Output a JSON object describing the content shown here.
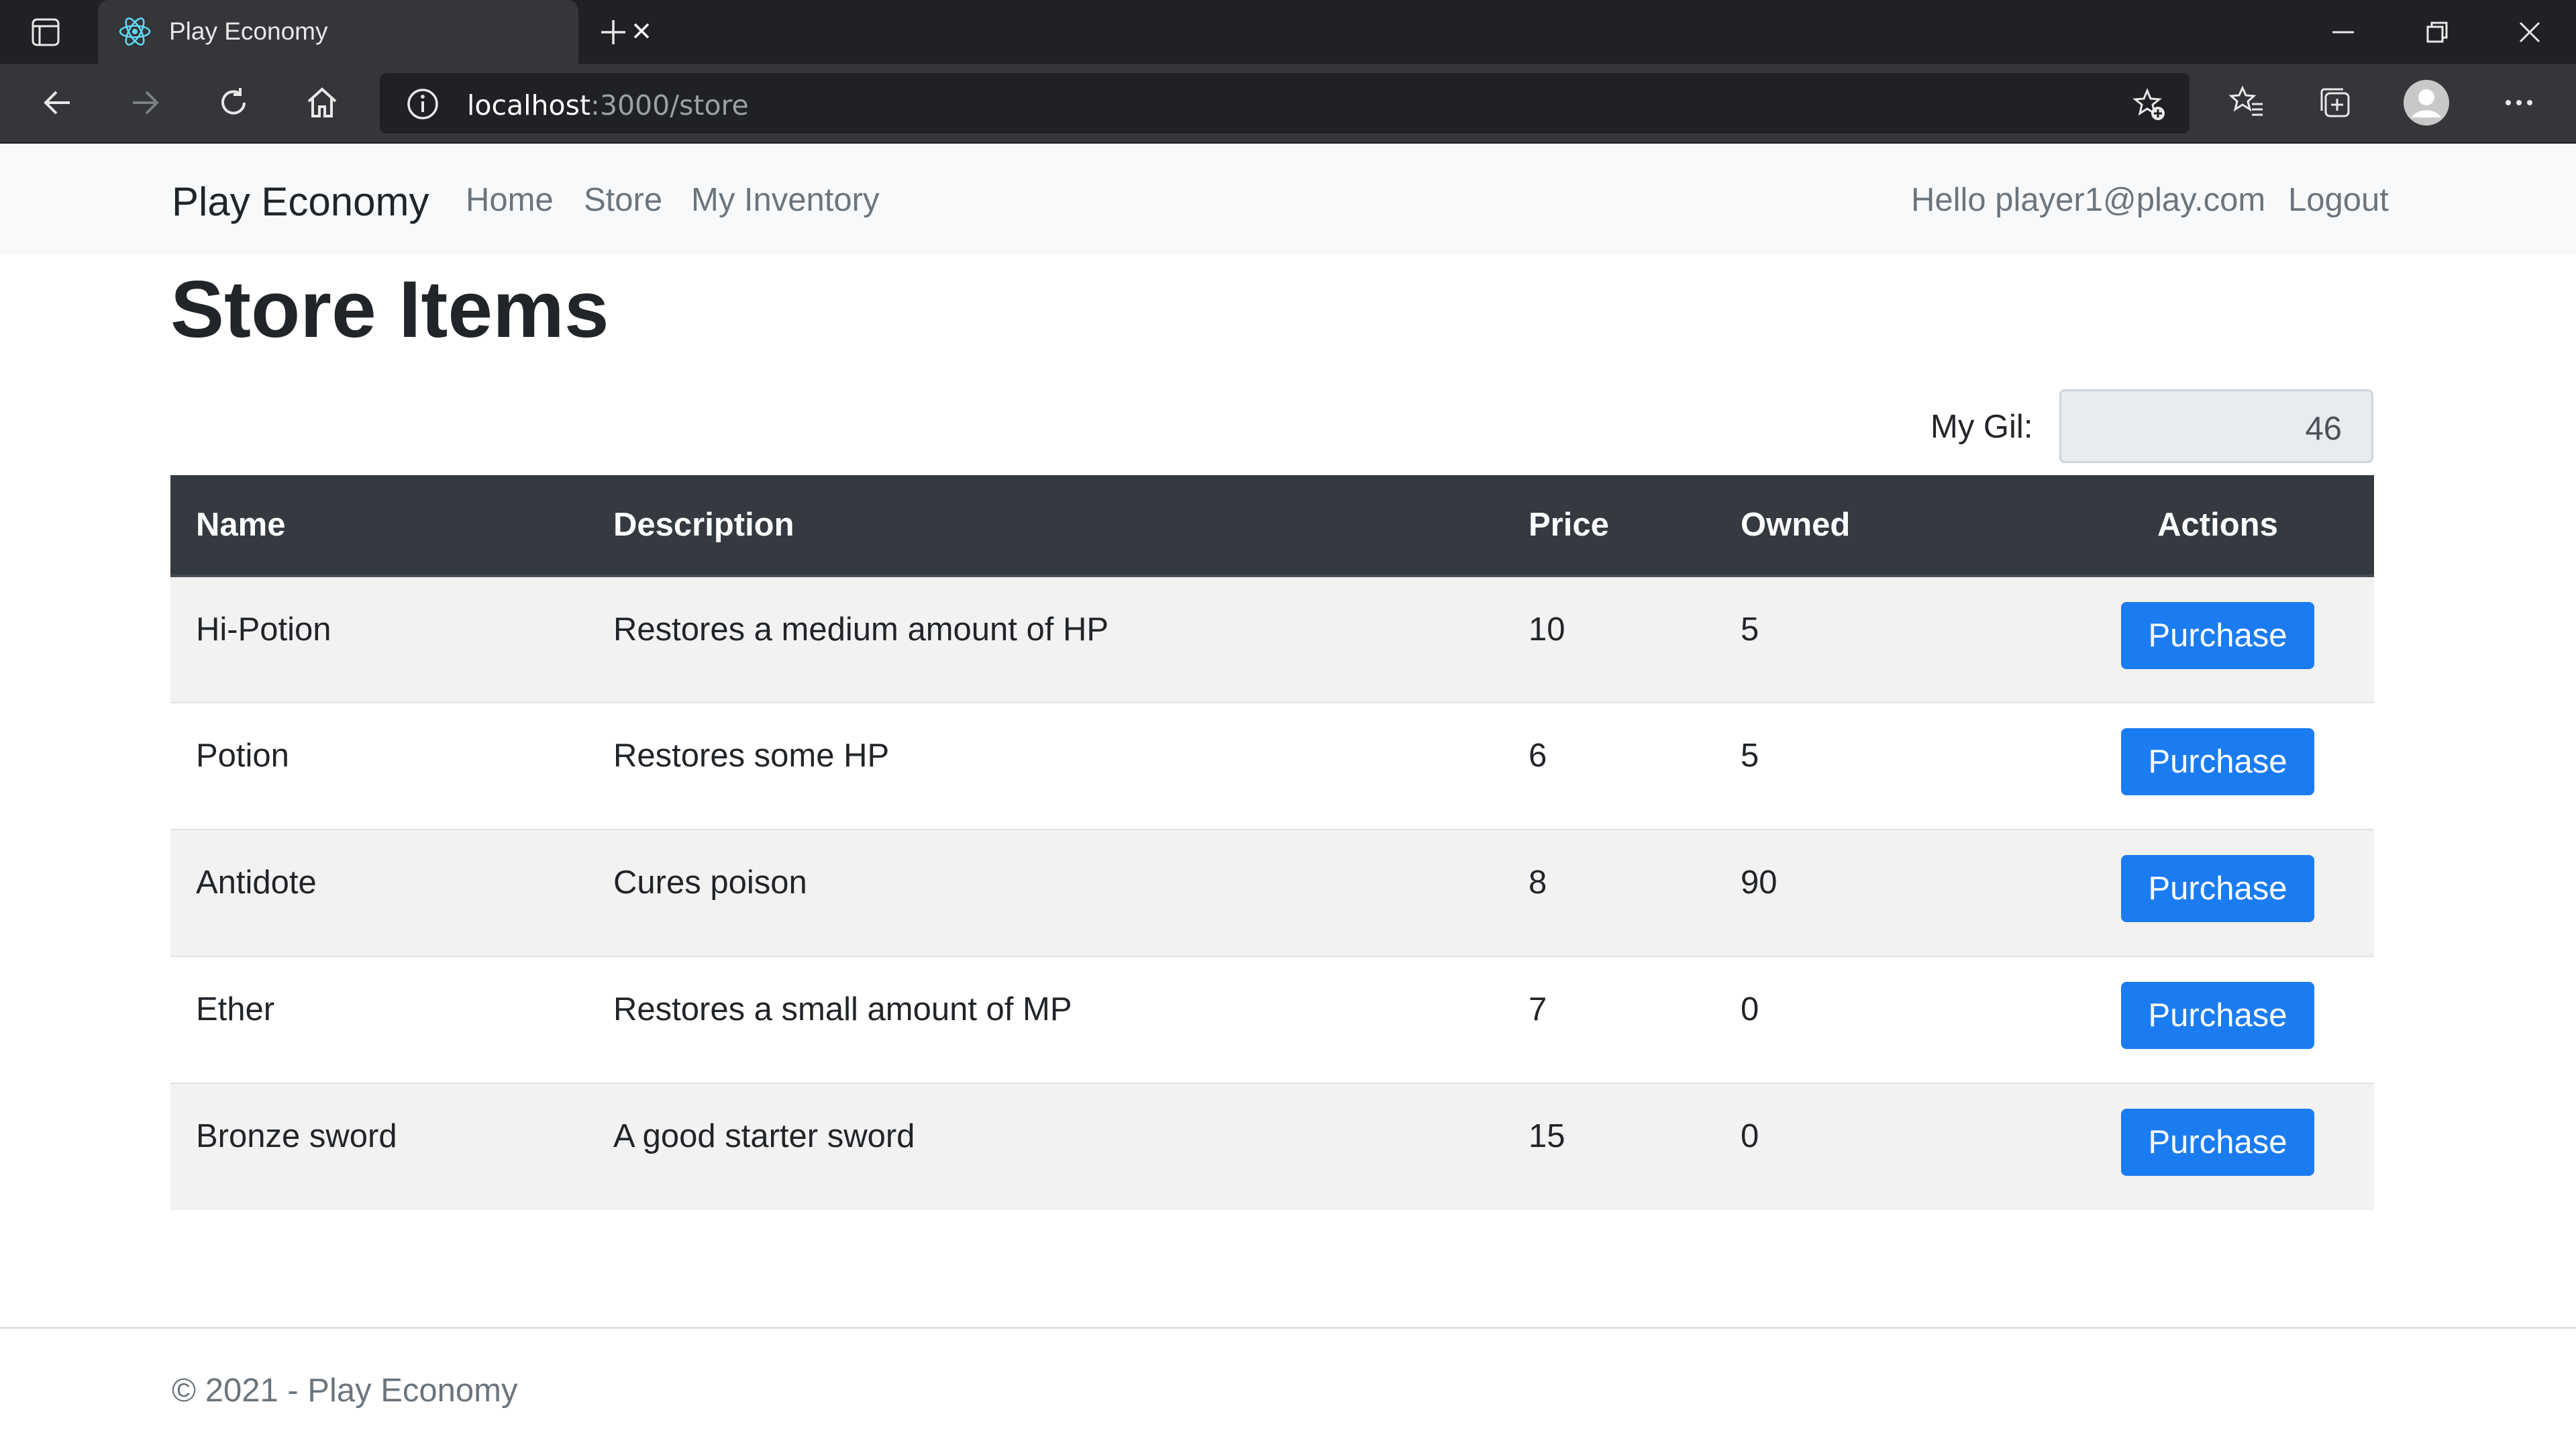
{
  "browser": {
    "tab_title": "Play Economy",
    "url_host": "localhost",
    "url_path": ":3000/store"
  },
  "nav": {
    "brand": "Play Economy",
    "links": [
      "Home",
      "Store",
      "My Inventory"
    ],
    "greeting": "Hello player1@play.com",
    "logout": "Logout"
  },
  "page": {
    "title": "Store Items",
    "gil_label": "My Gil:",
    "gil_value": "46"
  },
  "table": {
    "headers": [
      "Name",
      "Description",
      "Price",
      "Owned",
      "Actions"
    ],
    "rows": [
      {
        "name": "Hi-Potion",
        "description": "Restores a medium amount of HP",
        "price": "10",
        "owned": "5",
        "action": "Purchase"
      },
      {
        "name": "Potion",
        "description": "Restores some HP",
        "price": "6",
        "owned": "5",
        "action": "Purchase"
      },
      {
        "name": "Antidote",
        "description": "Cures poison",
        "price": "8",
        "owned": "90",
        "action": "Purchase"
      },
      {
        "name": "Ether",
        "description": "Restores a small amount of MP",
        "price": "7",
        "owned": "0",
        "action": "Purchase"
      },
      {
        "name": "Bronze sword",
        "description": "A good starter sword",
        "price": "15",
        "owned": "0",
        "action": "Purchase"
      }
    ]
  },
  "footer": {
    "text": "© 2021 - Play Economy"
  },
  "colors": {
    "primary_button": "#1b7cf2",
    "table_header": "#343a40",
    "browser_dark": "#202124"
  }
}
